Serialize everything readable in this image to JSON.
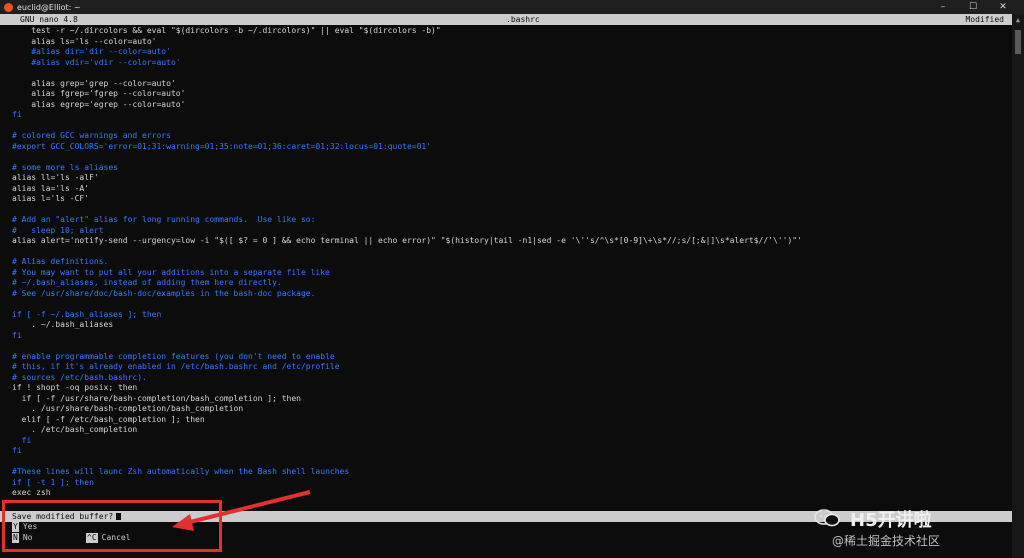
{
  "window": {
    "title": "euclid@Elliot: ~",
    "minimize_label": "–",
    "maximize_label": "☐",
    "close_label": "✕"
  },
  "nano": {
    "version": "GNU nano 4.8",
    "filename": ".bashrc",
    "status": "Modified"
  },
  "colors": {
    "comment": "#3b78ff",
    "keyword": "#c50f1f",
    "text": "#d6d6d6",
    "highlight": "#e03030",
    "header_bg": "#cccccc"
  },
  "editor_lines": [
    {
      "text": "    test -r ~/.dircolors && eval \"$(dircolors -b ~/.dircolors)\" || eval \"$(dircolors -b)\"",
      "cls": "c-white"
    },
    {
      "text": "    alias ls='ls --color=auto'",
      "cls": "c-white"
    },
    {
      "text": "    #alias dir='dir --color=auto'",
      "cls": "c-comment"
    },
    {
      "text": "    #alias vdir='vdir --color=auto'",
      "cls": "c-comment"
    },
    {
      "text": "",
      "cls": "c-white"
    },
    {
      "text": "    alias grep='grep --color=auto'",
      "cls": "c-white"
    },
    {
      "text": "    alias fgrep='fgrep --color=auto'",
      "cls": "c-white"
    },
    {
      "text": "    alias egrep='egrep --color=auto'",
      "cls": "c-white"
    },
    {
      "text": "fi",
      "cls": "c-comment"
    },
    {
      "text": "",
      "cls": "c-white"
    },
    {
      "text": "# colored GCC warnings and errors",
      "cls": "c-comment"
    },
    {
      "text": "#export GCC_COLORS='error=01;31:warning=01;35:note=01;36:caret=01;32:locus=01:quote=01'",
      "cls": "c-comment"
    },
    {
      "text": "",
      "cls": "c-white"
    },
    {
      "text": "# some more ls aliases",
      "cls": "c-comment"
    },
    {
      "text": "alias ll='ls -alF'",
      "cls": "c-white"
    },
    {
      "text": "alias la='ls -A'",
      "cls": "c-white"
    },
    {
      "text": "alias l='ls -CF'",
      "cls": "c-white"
    },
    {
      "text": "",
      "cls": "c-white"
    },
    {
      "text": "# Add an \"alert\" alias for long running commands.  Use like so:",
      "cls": "c-comment"
    },
    {
      "text": "#   sleep 10; alert",
      "cls": "c-comment"
    },
    {
      "text": "alias alert='notify-send --urgency=low -i \"$([ $? = 0 ] && echo terminal || echo error)\" \"$(history|tail -n1|sed -e '\\''s/^\\s*[0-9]\\+\\s*//;s/[;&|]\\s*alert$//'\\'')\"'",
      "cls": "c-white"
    },
    {
      "text": "",
      "cls": "c-white"
    },
    {
      "text": "# Alias definitions.",
      "cls": "c-comment"
    },
    {
      "text": "# You may want to put all your additions into a separate file like",
      "cls": "c-comment"
    },
    {
      "text": "# ~/.bash_aliases, instead of adding them here directly.",
      "cls": "c-comment"
    },
    {
      "text": "# See /usr/share/doc/bash-doc/examples in the bash-doc package.",
      "cls": "c-comment"
    },
    {
      "text": "",
      "cls": "c-white"
    },
    {
      "text": "if [ -f ~/.bash_aliases ]; then",
      "cls": "c-comment"
    },
    {
      "text": "    . ~/.bash_aliases",
      "cls": "c-white"
    },
    {
      "text": "fi",
      "cls": "c-comment"
    },
    {
      "text": "",
      "cls": "c-white"
    },
    {
      "text": "# enable programmable completion features (you don't need to enable",
      "cls": "c-comment"
    },
    {
      "text": "# this, if it's already enabled in /etc/bash.bashrc and /etc/profile",
      "cls": "c-comment"
    },
    {
      "text": "# sources /etc/bash.bashrc).",
      "cls": "c-comment"
    },
    {
      "text": "if ! shopt -oq posix; then",
      "cls": "c-white"
    },
    {
      "text": "  if [ -f /usr/share/bash-completion/bash_completion ]; then",
      "cls": "c-white"
    },
    {
      "text": "    . /usr/share/bash-completion/bash_completion",
      "cls": "c-white"
    },
    {
      "text": "  elif [ -f /etc/bash_completion ]; then",
      "cls": "c-white"
    },
    {
      "text": "    . /etc/bash_completion",
      "cls": "c-white"
    },
    {
      "text": "  fi",
      "cls": "c-comment"
    },
    {
      "text": "fi",
      "cls": "c-comment"
    },
    {
      "text": "",
      "cls": "c-white"
    },
    {
      "text": "#These lines will launc Zsh automatically when the Bash shell launches",
      "cls": "c-comment"
    },
    {
      "text": "if [ -t 1 ]; then",
      "cls": "c-comment"
    },
    {
      "text": "exec zsh",
      "cls": "c-white"
    }
  ],
  "prompt": {
    "question": "Save modified buffer?",
    "yes_key": "Y",
    "yes_label": "Yes",
    "no_key": "N",
    "no_label": "No",
    "cancel_key": "^C",
    "cancel_label": "Cancel"
  },
  "watermark": {
    "title": "H5开讲啦",
    "subtitle": "@稀土掘金技术社区"
  }
}
